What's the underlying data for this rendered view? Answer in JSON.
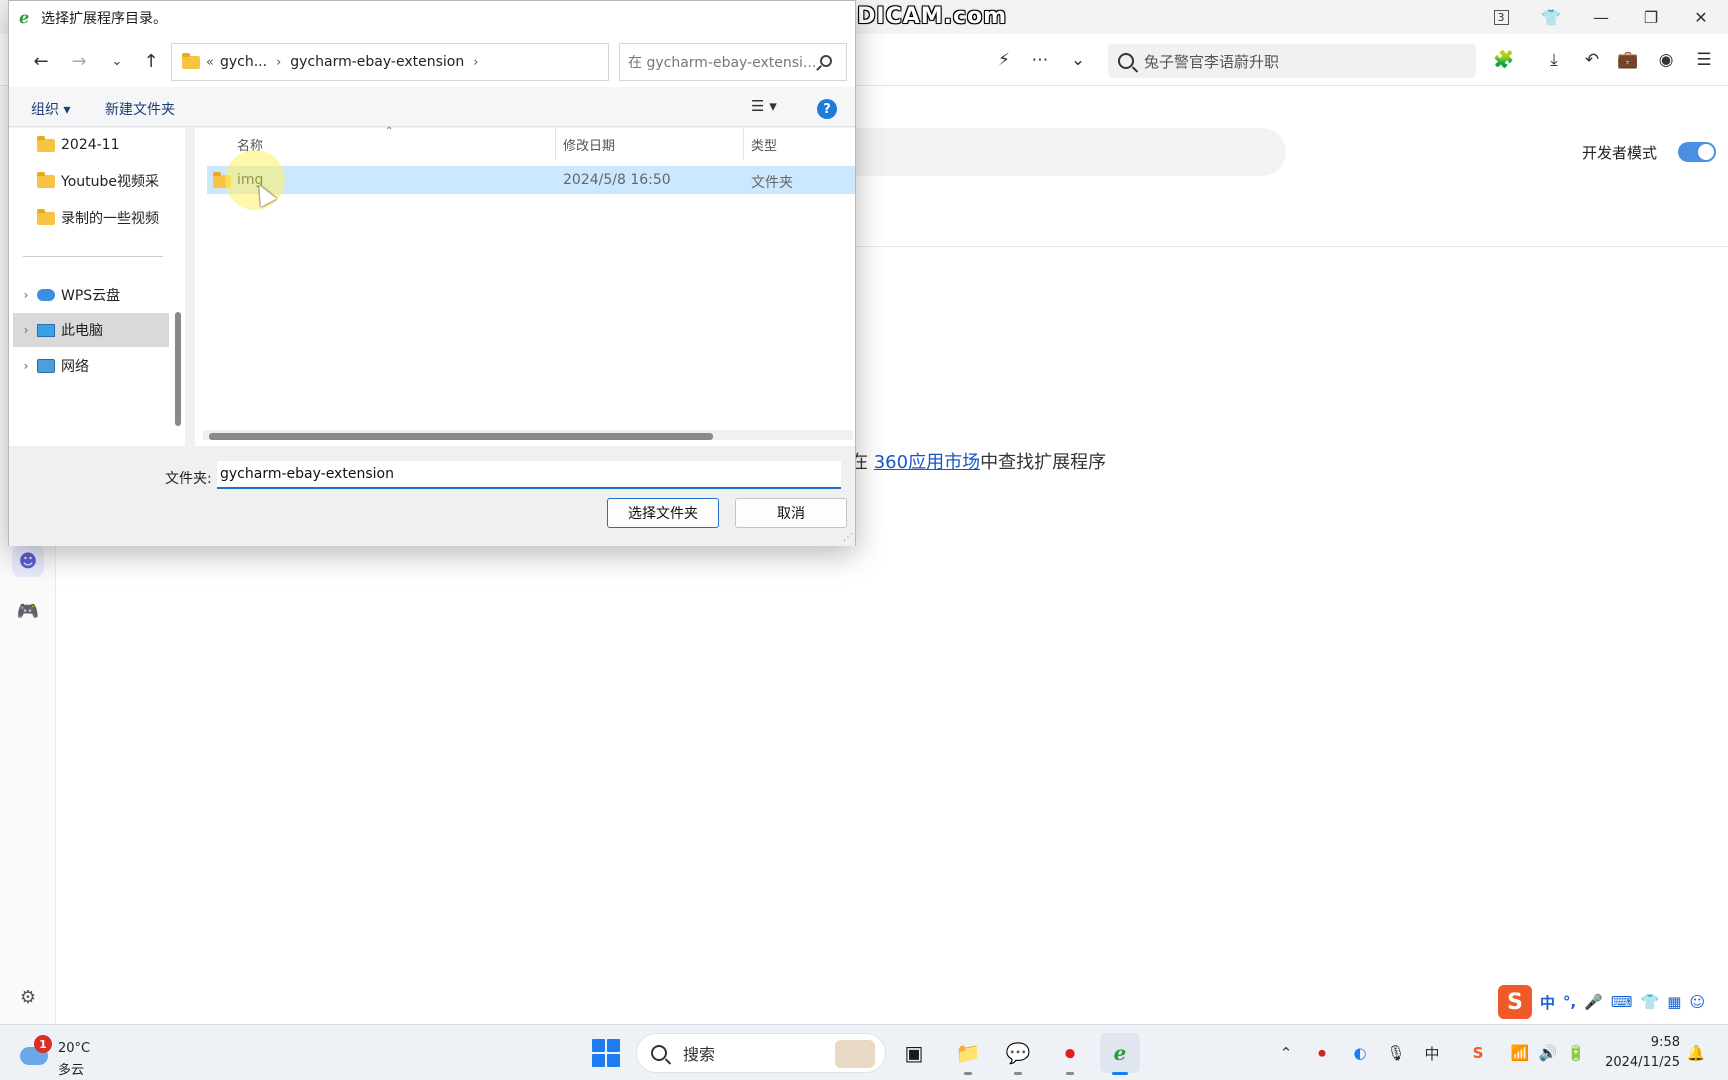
{
  "watermark": "www.BANDICAM.com",
  "browser": {
    "tab_count": "3",
    "search_placeholder": "兔子警官李语蔚升职",
    "developer_mode_label": "开发者模式",
    "market_prefix": "在",
    "market_link": "360应用市场",
    "market_suffix": "中查找扩展程序"
  },
  "dialog": {
    "title": "选择扩展程序目录。",
    "breadcrumb": {
      "overflow": "«",
      "items": [
        "gych...",
        "gycharm-ebay-extension"
      ]
    },
    "search_placeholder": "在 gycharm-ebay-extensi...",
    "commands": {
      "organize": "组织 ▾",
      "new_folder": "新建文件夹"
    },
    "nav_items": [
      {
        "label": "2024-11"
      },
      {
        "label": "Youtube视频采"
      },
      {
        "label": "录制的一些视频"
      },
      {
        "label": "WPS云盘"
      },
      {
        "label": "此电脑"
      },
      {
        "label": "网络"
      }
    ],
    "columns": {
      "name": "名称",
      "modified": "修改日期",
      "type": "类型"
    },
    "files": [
      {
        "name": "img",
        "modified": "2024/5/8 16:50",
        "type": "文件夹"
      }
    ],
    "folder_label": "文件夹:",
    "folder_value": "gycharm-ebay-extension",
    "select_button": "选择文件夹",
    "cancel_button": "取消"
  },
  "ime": {
    "logo": "S",
    "items": [
      "中",
      "°,",
      "🎤",
      "⌨",
      "👕",
      "▦",
      "☺"
    ]
  },
  "taskbar": {
    "weather_badge": "1",
    "temperature": "20°C",
    "weather_desc": "多云",
    "search_label": "搜索",
    "time": "9:58",
    "date": "2024/11/25",
    "ime_lang": "中"
  }
}
